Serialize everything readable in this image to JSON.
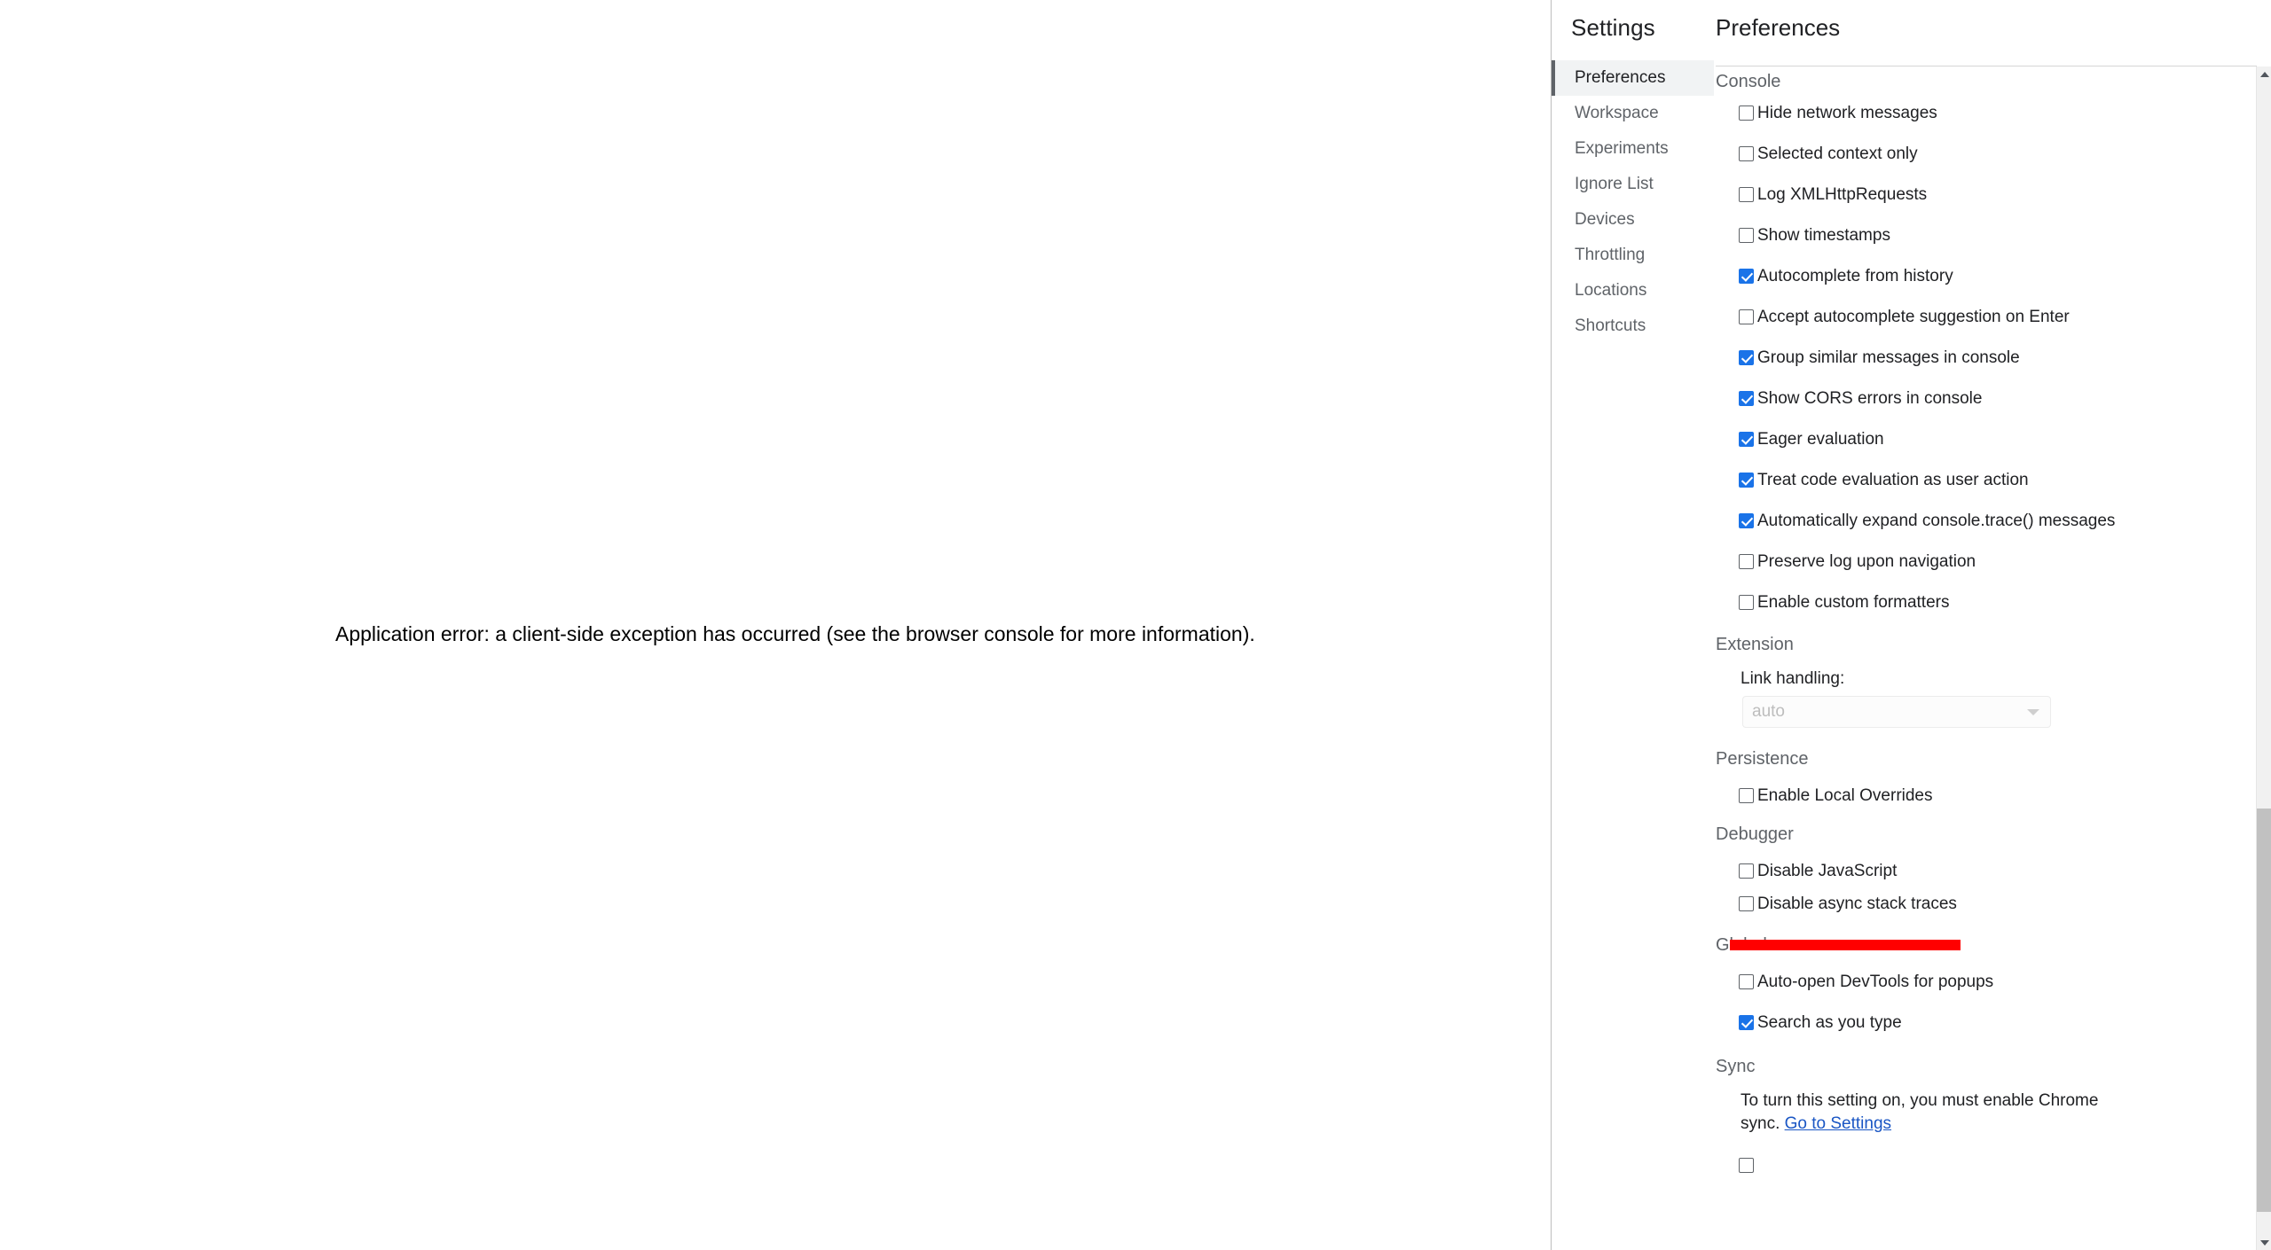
{
  "page": {
    "error_message": "Application error: a client-side exception has occurred (see the browser console for more information)."
  },
  "settings_dialog": {
    "title": "Settings",
    "close_icon": "close-icon",
    "nav_items": [
      {
        "label": "Preferences",
        "selected": true
      },
      {
        "label": "Workspace",
        "selected": false
      },
      {
        "label": "Experiments",
        "selected": false
      },
      {
        "label": "Ignore List",
        "selected": false
      },
      {
        "label": "Devices",
        "selected": false
      },
      {
        "label": "Throttling",
        "selected": false
      },
      {
        "label": "Locations",
        "selected": false
      },
      {
        "label": "Shortcuts",
        "selected": false
      }
    ],
    "content_title": "Preferences",
    "sections": {
      "console": {
        "title": "Console",
        "options": [
          {
            "label": "Hide network messages",
            "checked": false
          },
          {
            "label": "Selected context only",
            "checked": false
          },
          {
            "label": "Log XMLHttpRequests",
            "checked": false
          },
          {
            "label": "Show timestamps",
            "checked": false
          },
          {
            "label": "Autocomplete from history",
            "checked": true
          },
          {
            "label": "Accept autocomplete suggestion on Enter",
            "checked": false
          },
          {
            "label": "Group similar messages in console",
            "checked": true
          },
          {
            "label": "Show CORS errors in console",
            "checked": true
          },
          {
            "label": "Eager evaluation",
            "checked": true
          },
          {
            "label": "Treat code evaluation as user action",
            "checked": true
          },
          {
            "label": "Automatically expand console.trace() messages",
            "checked": true
          },
          {
            "label": "Preserve log upon navigation",
            "checked": false
          },
          {
            "label": "Enable custom formatters",
            "checked": false
          }
        ]
      },
      "extension": {
        "title": "Extension",
        "link_handling_label": "Link handling:",
        "link_handling_value": "auto"
      },
      "persistence": {
        "title": "Persistence",
        "options": [
          {
            "label": "Enable Local Overrides",
            "checked": false
          }
        ]
      },
      "debugger": {
        "title": "Debugger",
        "options": [
          {
            "label": "Disable JavaScript",
            "checked": false
          },
          {
            "label": "Disable async stack traces",
            "checked": false
          }
        ]
      },
      "global": {
        "title": "Global",
        "options": [
          {
            "label": "Auto-open DevTools for popups",
            "checked": false
          },
          {
            "label": "Search as you type",
            "checked": true
          }
        ]
      },
      "sync": {
        "title": "Sync",
        "note_before_link": "To turn this setting on, you must enable Chrome sync. ",
        "note_link": "Go to Settings"
      }
    }
  },
  "annotation": {
    "color": "#ff0000"
  },
  "colors": {
    "accent_blue": "#1a73e8",
    "link_blue": "#1a56c4",
    "section_title_gray": "#5f6368",
    "text_primary": "#202124",
    "annotation_red": "#ff0000",
    "selected_nav_bg": "#f1f3f4",
    "scrollbar_thumb": "#c1c1c1"
  }
}
